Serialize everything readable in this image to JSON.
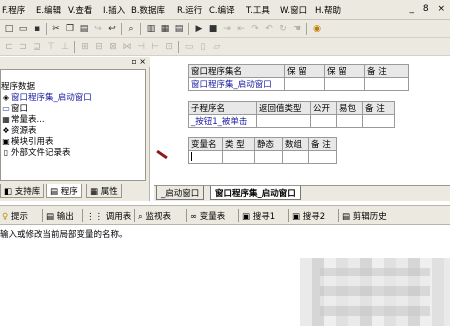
{
  "menubar": {
    "items": [
      {
        "label": "F.程序"
      },
      {
        "label": "E.编辑"
      },
      {
        "label": "V.查看"
      },
      {
        "label": "I.插入"
      },
      {
        "label": "B.数据库"
      },
      {
        "label": "R.运行"
      },
      {
        "label": "C.编译"
      },
      {
        "label": "T.工具"
      },
      {
        "label": "W.窗口"
      },
      {
        "label": "H.帮助"
      }
    ],
    "window_controls": "_ 8 ×"
  },
  "tree": {
    "items": [
      {
        "label": "程序数据",
        "icon": "none"
      },
      {
        "label": "窗口程序集_启动窗口",
        "icon": "module-icon",
        "selected": true
      },
      {
        "label": "窗口",
        "icon": "window-icon"
      },
      {
        "label": "常量表...",
        "icon": "constant-table-icon"
      },
      {
        "label": "资源表",
        "icon": "resource-icon"
      },
      {
        "label": "模块引用表",
        "icon": "module-ref-icon"
      },
      {
        "label": "外部文件记录表",
        "icon": "file-icon"
      }
    ]
  },
  "left_tabs": [
    {
      "label": "支持库"
    },
    {
      "label": "程序"
    },
    {
      "label": "属性"
    }
  ],
  "assembly_table": {
    "headers": [
      "窗口程序集名",
      "保 留",
      "保 留",
      "备 注"
    ],
    "row": [
      "窗口程序集_启动窗口",
      "",
      "",
      ""
    ]
  },
  "sub_table": {
    "headers": [
      "子程序名",
      "返回值类型",
      "公开",
      "易包",
      "备 注"
    ],
    "row": [
      "_按钮1_被单击",
      "",
      "",
      "",
      ""
    ]
  },
  "var_table": {
    "headers": [
      "变量名",
      "类 型",
      "静态",
      "数组",
      "备 注"
    ],
    "row": [
      "",
      "",
      "",
      "",
      ""
    ]
  },
  "editor_tabs": [
    {
      "label": "_启动窗口"
    },
    {
      "label": "窗口程序集_启动窗口",
      "active": true
    }
  ],
  "bottom_tabs": [
    {
      "label": "提示",
      "icon": "hint-icon"
    },
    {
      "label": "输出",
      "icon": "output-icon"
    },
    {
      "label": "调用表",
      "icon": "call-table-icon"
    },
    {
      "label": "监视表",
      "icon": "watch-icon"
    },
    {
      "label": "变量表",
      "icon": "variable-icon"
    },
    {
      "label": "搜寻1",
      "icon": "search-icon"
    },
    {
      "label": "搜寻2",
      "icon": "search-icon"
    },
    {
      "label": "剪辑历史",
      "icon": "clip-history-icon"
    }
  ],
  "output": {
    "hint_text": "输入或修改当前局部变量的名称。"
  },
  "colors": {
    "chrome": "#ece9e0",
    "selected_text": "#1a1aa0",
    "border": "#9a978c"
  }
}
